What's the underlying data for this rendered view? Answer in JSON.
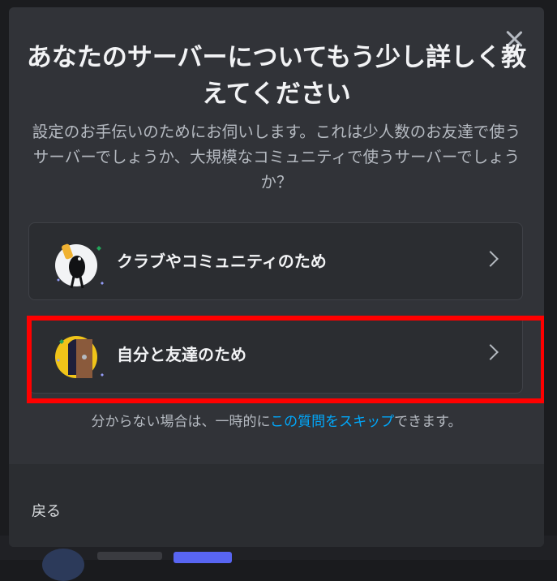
{
  "modal": {
    "title": "あなたのサーバーについてもう少し詳しく教えてください",
    "subtitle": "設定のお手伝いのためにお伺いします。これは少人数のお友達で使うサーバーでしょうか、大規模なコミュニティで使うサーバーでしょうか？",
    "close_icon": "close-icon"
  },
  "options": [
    {
      "label": "クラブやコミュニティのため",
      "icon": "club-illustration-icon"
    },
    {
      "label": "自分と友達のため",
      "icon": "friends-illustration-icon"
    }
  ],
  "hint": {
    "prefix": "分からない場合は、一時的に",
    "link": "この質問をスキップ",
    "suffix": "できます。"
  },
  "footer": {
    "back_label": "戻る"
  },
  "colors": {
    "modal_bg": "#313338",
    "option_bg": "#2b2d31",
    "link": "#00a8fc",
    "highlight": "#ff0000"
  }
}
